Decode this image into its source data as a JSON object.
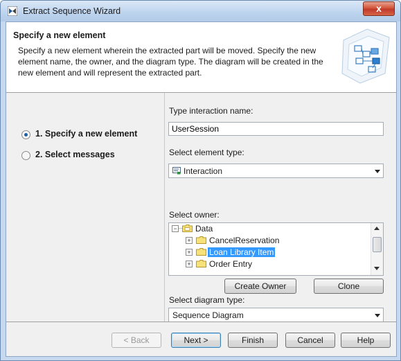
{
  "window": {
    "title": "Extract Sequence Wizard",
    "close_label": "x"
  },
  "header": {
    "title": "Specify a new element",
    "description": "Specify a new element wherein the extracted part will be moved. Specify the new element name, the owner, and the diagram type. The diagram will be created in the new element and will represent the extracted part."
  },
  "steps": [
    {
      "label": "1. Specify a new element",
      "selected": true
    },
    {
      "label": "2. Select messages",
      "selected": false
    }
  ],
  "form": {
    "interaction_name_label": "Type interaction name:",
    "interaction_name_value": "UserSession",
    "element_type_label": "Select element type:",
    "element_type_value": "Interaction",
    "element_type_icon": "interaction-icon",
    "owner_label": "Select owner:",
    "owner_tree": [
      {
        "label": "Data",
        "expanded": true,
        "level": 0,
        "icon": "package-icon"
      },
      {
        "label": "CancelReservation",
        "expanded": false,
        "level": 1,
        "icon": "folder-icon"
      },
      {
        "label": "Loan Library Item",
        "expanded": false,
        "level": 1,
        "icon": "folder-icon",
        "selected": true
      },
      {
        "label": "Order Entry",
        "expanded": false,
        "level": 1,
        "icon": "folder-icon"
      }
    ],
    "create_owner_label": "Create Owner",
    "clone_label": "Clone",
    "diagram_type_label": "Select diagram type:",
    "diagram_type_value": "Sequence Diagram"
  },
  "footer": {
    "back_label": "< Back",
    "next_label": "Next >",
    "finish_label": "Finish",
    "cancel_label": "Cancel",
    "help_label": "Help"
  },
  "colors": {
    "selection": "#3399ff",
    "radio_dot": "#1c5fa8",
    "titlebar": "#c7d9ef"
  }
}
